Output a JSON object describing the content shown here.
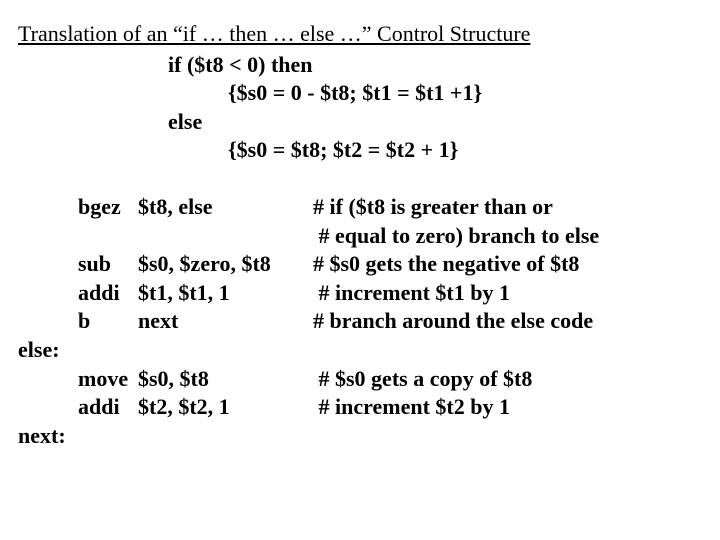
{
  "title": "Translation of an “if … then … else …” Control Structure",
  "pseudo": {
    "if": "if",
    "cond": "($t8 < 0)",
    "then": "then",
    "then_body": "{$s0 = 0 - $t8; $t1 = $t1 +1}",
    "else": "else",
    "else_body": "{$s0 =  $t8;  $t2 = $t2 + 1}"
  },
  "asm": {
    "rows": [
      {
        "label": "",
        "mnem": "bgez",
        "args": "$t8, else",
        "cmt": "# if ($t8 is greater than or"
      },
      {
        "label": "",
        "mnem": "",
        "args": "",
        "cmt": " # equal to zero) branch to else"
      },
      {
        "label": "",
        "mnem": "sub",
        "args": "$s0, $zero, $t8",
        "cmt": "# $s0 gets the negative of $t8"
      },
      {
        "label": "",
        "mnem": "addi",
        "args": "$t1, $t1, 1",
        "cmt": " # increment $t1 by 1"
      },
      {
        "label": "",
        "mnem": "b",
        "args": "next",
        "cmt": "# branch around the else code"
      },
      {
        "label": "else:",
        "mnem": "",
        "args": "",
        "cmt": ""
      },
      {
        "label": "",
        "mnem": "move",
        "args": "$s0, $t8",
        "cmt": " # $s0 gets a copy of $t8"
      },
      {
        "label": "",
        "mnem": "addi",
        "args": "$t2, $t2, 1",
        "cmt": " # increment $t2 by 1"
      },
      {
        "label": "next:",
        "mnem": "",
        "args": "",
        "cmt": ""
      }
    ]
  }
}
